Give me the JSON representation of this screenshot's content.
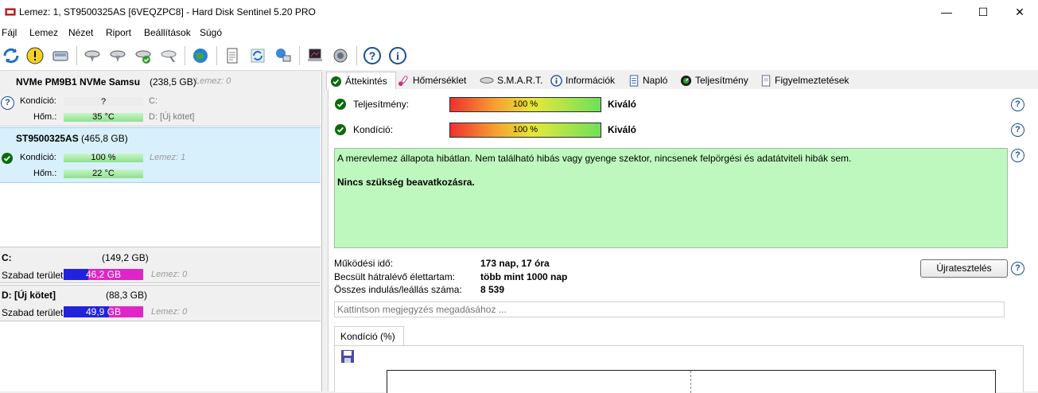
{
  "window": {
    "title": "Lemez: 1, ST9500325AS [6VEQZPC8]  -  Hard Disk Sentinel 5.20 PRO",
    "minimize": "—",
    "maximize": "☐",
    "close": "✕"
  },
  "menu": [
    "Fájl",
    "Lemez",
    "Nézet",
    "Riport",
    "Beállítások",
    "Súgó"
  ],
  "toolbar": {
    "icons": [
      "refresh-icon",
      "warning-icon",
      "disk-icon",
      "disk-gear-icon",
      "disk-gear2-icon",
      "disk-check-icon",
      "disk-wrench-icon",
      "globe-icon",
      "report-icon",
      "sync-icon",
      "network-icon",
      "laptop-icon",
      "speaker-icon",
      "help-icon",
      "info-icon"
    ]
  },
  "disks": [
    {
      "name": "NVMe    PM9B1 NVMe Samsu",
      "size": "(238,5 GB)",
      "lemez": "Lemez: 0",
      "kondicio_label": "Kondíció:",
      "kondicio_value": "?",
      "hom_label": "Hőm.:",
      "hom_value": "35 °C",
      "drive1": "C:",
      "drive2": "D: [Új kötet]"
    },
    {
      "name": "ST9500325AS",
      "size": "(465,8 GB)",
      "lemez": "Lemez: 1",
      "kondicio_label": "Kondíció:",
      "kondicio_value": "100 %",
      "hom_label": "Hőm.:",
      "hom_value": "22 °C"
    }
  ],
  "volumes": [
    {
      "name": "C:",
      "size": "(149,2 GB)",
      "free_label": "Szabad terület",
      "free_value": "46,2 GB",
      "free_fraction": 0.31,
      "lemez": "Lemez: 0"
    },
    {
      "name": "D: [Új kötet]",
      "size": "(88,3 GB)",
      "free_label": "Szabad terület",
      "free_value": "49,9 GB",
      "free_fraction": 0.57,
      "lemez": "Lemez: 0"
    }
  ],
  "tabs": [
    "Áttekintés",
    "Hőmérséklet",
    "S.M.A.R.T.",
    "Információk",
    "Napló",
    "Teljesítmény",
    "Figyelmeztetések"
  ],
  "overview": {
    "perf_label": "Teljesítmény:",
    "perf_value": "100 %",
    "perf_percent": 100,
    "perf_rating": "Kiváló",
    "cond_label": "Kondíció:",
    "cond_value": "100 %",
    "cond_percent": 100,
    "cond_rating": "Kiváló",
    "message1": "A merevlemez állapota hibátlan. Nem található hibás vagy gyenge szektor, nincsenek felpörgési és adatátviteli hibák sem.",
    "message2": "Nincs szükség beavatkozásra.",
    "uptime_label": "Működési idő:",
    "uptime_value": "173 nap, 17 óra",
    "life_label": "Becsült hátralévő élettartam:",
    "life_value": "több mint 1000 nap",
    "starts_label": "Összes indulás/leállás száma:",
    "starts_value": "8 539",
    "retest_button": "Újratesztelés",
    "comment_placeholder": "Kattintson megjegyzés megadásához ...",
    "subtab": "Kondíció  (%)",
    "help": "?"
  },
  "colors": {
    "selected_row": "#d7f0fb",
    "info_green": "#bff8bf",
    "free_bar_blue": "#2222dd",
    "free_bar_magenta": "#e025c8"
  }
}
